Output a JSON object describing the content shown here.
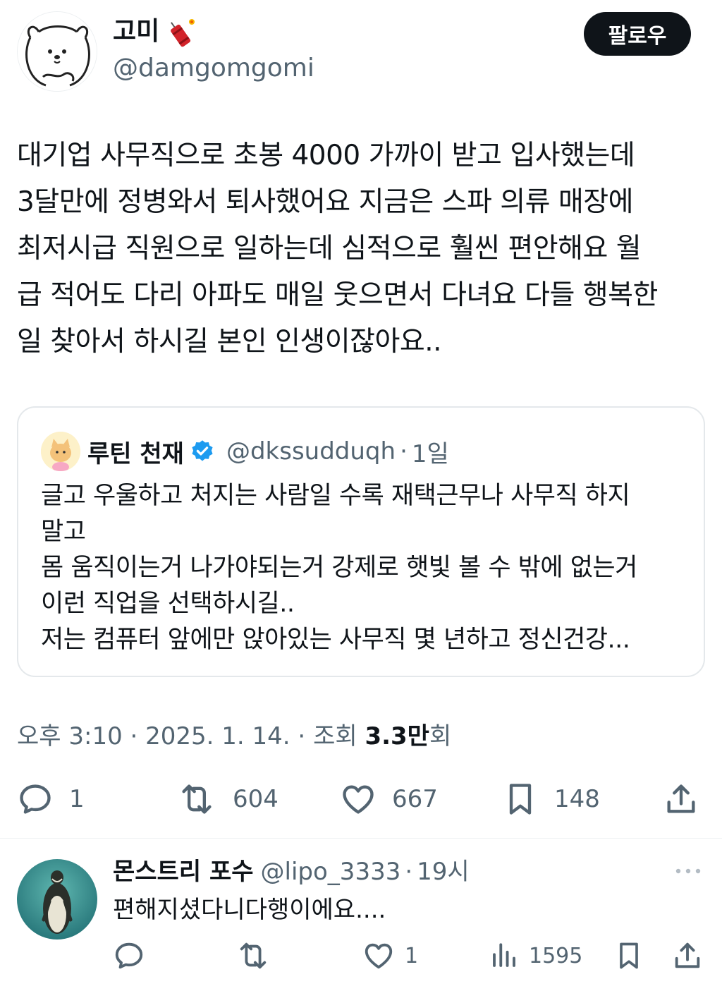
{
  "author": {
    "display_name": "고미",
    "handle": "@damgomgomi",
    "avatar_icon": "bear-avatar",
    "name_emoji_icon": "firecracker-icon"
  },
  "follow_button": {
    "label": "팔로우"
  },
  "tweet": {
    "lines": [
      "대기업 사무직으로 초봉 4000 가까이 받고 입사했는데",
      "3달만에 정병와서 퇴사했어요 지금은 스파 의류 매장에",
      "최저시급 직원으로 일하는데 심적으로 훨씬 편안해요 월",
      "급 적어도 다리 아파도 매일 웃으면서 다녀요 다들 행복한",
      "일 찾아서 하시길 본인 인생이잖아요.."
    ]
  },
  "quote": {
    "display_name": "루틴 천재",
    "verified_icon": "verified-badge-icon",
    "handle": "@dkssudduqh",
    "separator": "·",
    "time": "1일",
    "lines": [
      "글고 우울하고 처지는 사람일 수록 재택근무나 사무직 하지",
      "말고",
      "몸 움직이는거 나가야되는거 강제로 햇빛 볼 수 밖에 없는거",
      "이런 직업을 선택하시길..",
      "저는 컴퓨터 앞에만 앉아있는 사무직 몇 년하고 정신건강..."
    ]
  },
  "meta": {
    "time": "오후 3:10",
    "sep1": " · ",
    "date": "2025. 1. 14.",
    "sep2": " · ",
    "views_label": "조회 ",
    "views_count": "3.3만",
    "views_suffix": "회"
  },
  "actions": {
    "replies": "1",
    "reposts": "604",
    "likes": "667",
    "bookmarks": "148"
  },
  "reply": {
    "display_name": "몬스트리 포수",
    "handle": "@lipo_3333",
    "separator": "·",
    "time": "19시",
    "text": "편해지셨다니다행이에요....",
    "likes": "1",
    "views": "1595"
  },
  "colors": {
    "text": "#0f1419",
    "secondary": "#536471",
    "border": "#e4e8eb",
    "verified": "#1d9bf0",
    "button_bg": "#0f1419"
  }
}
